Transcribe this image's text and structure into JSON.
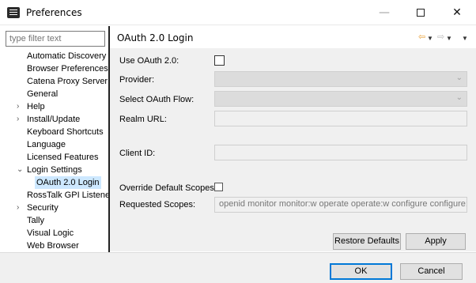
{
  "window": {
    "title": "Preferences",
    "minimize_glyph": "—",
    "close_glyph": "✕"
  },
  "sidebar": {
    "filter_placeholder": "type filter text",
    "items": [
      {
        "label": "Automatic Discovery",
        "expandable": false
      },
      {
        "label": "Browser Preferences",
        "expandable": false
      },
      {
        "label": "Catena Proxy Server",
        "expandable": false
      },
      {
        "label": "General",
        "expandable": false
      },
      {
        "label": "Help",
        "expandable": true,
        "expanded": false
      },
      {
        "label": "Install/Update",
        "expandable": true,
        "expanded": false
      },
      {
        "label": "Keyboard Shortcuts",
        "expandable": false
      },
      {
        "label": "Language",
        "expandable": false
      },
      {
        "label": "Licensed Features",
        "expandable": false
      },
      {
        "label": "Login Settings",
        "expandable": true,
        "expanded": true
      },
      {
        "label": "OAuth 2.0 Login",
        "expandable": false,
        "child": true,
        "selected": true
      },
      {
        "label": "RossTalk GPI Listener",
        "expandable": false
      },
      {
        "label": "Security",
        "expandable": true,
        "expanded": false
      },
      {
        "label": "Tally",
        "expandable": false
      },
      {
        "label": "Visual Logic",
        "expandable": false
      },
      {
        "label": "Web Browser",
        "expandable": false
      }
    ],
    "twist_collapsed": "›",
    "twist_expanded": "⌄"
  },
  "page": {
    "title": "OAuth 2.0 Login",
    "nav_back_icon": "⇦",
    "nav_forward_icon": "⇨",
    "dropdown_glyph": "▼"
  },
  "form": {
    "use_oauth_label": "Use OAuth 2.0:",
    "use_oauth_checked": false,
    "provider_label": "Provider:",
    "flow_label": "Select OAuth Flow:",
    "realm_label": "Realm URL:",
    "client_id_label": "Client ID:",
    "override_scopes_label": "Override Default Scopes:",
    "override_scopes_checked": false,
    "requested_scopes_label": "Requested Scopes:",
    "requested_scopes_value": "openid monitor monitor:w operate operate:w configure configure:w",
    "combo_chevron": "⌄"
  },
  "buttons": {
    "restore_defaults": "Restore Defaults",
    "apply": "Apply",
    "ok": "OK",
    "cancel": "Cancel"
  }
}
